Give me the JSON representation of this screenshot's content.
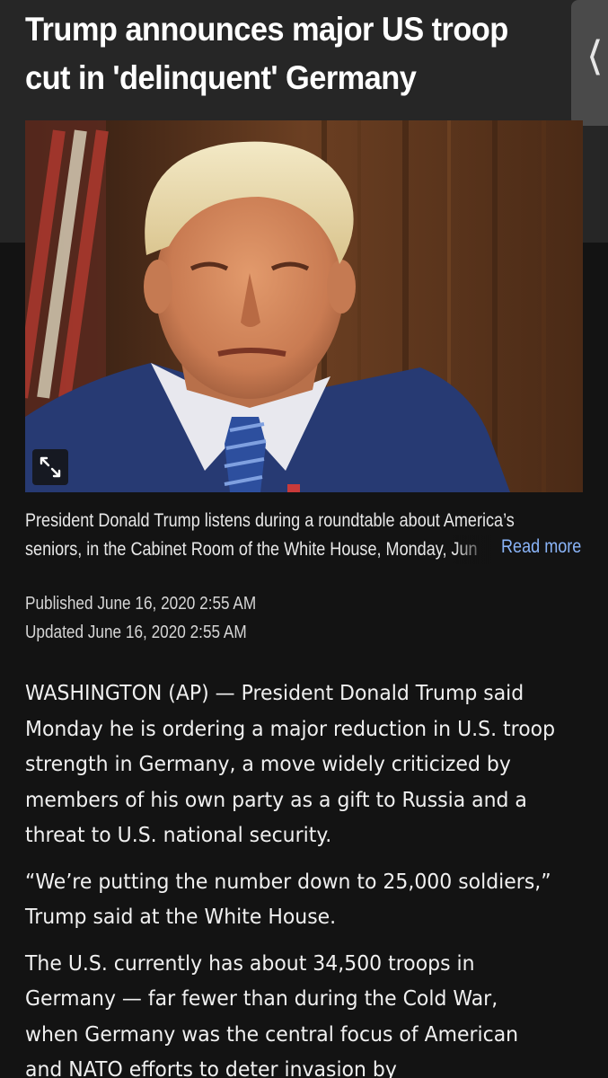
{
  "article": {
    "headline": "Trump announces major US troop cut in 'delinquent' Germany",
    "photo": {
      "description_icon": "expand-icon"
    },
    "caption_line1": "President Donald Trump listens during a roundtable about America’s",
    "caption_line2": "seniors, in the Cabinet Room of the White House, Monday, Jun",
    "read_more": "Read more",
    "published": "Published June 16, 2020 2:55 AM",
    "updated": "Updated June 16, 2020 2:55 AM",
    "paragraphs": [
      "WASHINGTON (AP) — President Donald Trump said Monday he is ordering a major reduction in U.S. troop strength in Germany, a move widely criticized by members of his own party as a gift to Russia and a threat to U.S. national security.",
      "“We’re putting the number down to 25,000 soldiers,” Trump said at the White House.",
      "The U.S. currently has about 34,500 troops in Germany — far fewer than during the Cold War, when Germany was the central focus of American and NATO efforts to deter invasion by"
    ]
  },
  "ui": {
    "back_icon": "chevron-left-icon",
    "colors": {
      "background": "#131313",
      "header": "#262626",
      "link": "#8ab4f8"
    }
  }
}
